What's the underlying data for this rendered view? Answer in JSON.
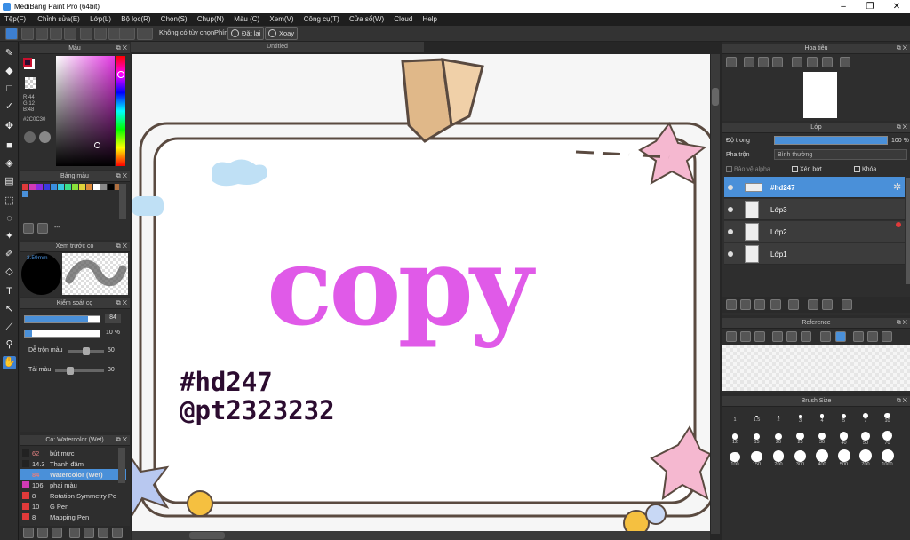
{
  "app": {
    "title": "MediBang Paint Pro (64bit)"
  },
  "menu": [
    "Tệp(F)",
    "Chỉnh sửa(E)",
    "Lớp(L)",
    "Bộ lọc(R)",
    "Chọn(S)",
    "Chụp(N)",
    "Màu (C)",
    "Xem(V)",
    "Công cụ(T)",
    "Cửa sổ(W)",
    "Cloud",
    "Help"
  ],
  "toolbar": {
    "no_option": "Không có tùy chọn",
    "phim": "Phím",
    "reset": "Đặt lại",
    "rotate": "Xoay"
  },
  "canvas": {
    "tab": "Untitled",
    "watermark1": "#hd247",
    "watermark2": "@pt2323232",
    "art_text": "copy"
  },
  "color_panel": {
    "title": "Màu",
    "r": "R:44",
    "g": "G:12",
    "b": "B:48",
    "hex": "#2C0C30",
    "fg": "#c8102e",
    "bg": "#ffffff"
  },
  "palette_panel": {
    "title": "Bảng màu",
    "dash": "---",
    "swatches": [
      "#e03a3a",
      "#d23ab5",
      "#8a2be2",
      "#3a3ae0",
      "#3a8ee0",
      "#3ac8e0",
      "#3ae08a",
      "#8ae03a",
      "#e0d23a",
      "#e08a3a",
      "#ffffff",
      "#888888",
      "#000000",
      "#b07040",
      "#4a90d9"
    ]
  },
  "brush_preview": {
    "title": "Xem trước cọ",
    "size": "3.59mm"
  },
  "brush_control": {
    "title": "Kiểm soát cọ",
    "size": "84",
    "opacity": "10 %",
    "blend_label": "Dễ trộn màu",
    "blend_value": "50",
    "reload_label": "Tải màu",
    "reload_value": "30",
    "size_frac": 0.84,
    "opacity_frac": 0.1,
    "blend_frac": 0.5,
    "reload_frac": 0.3
  },
  "brush_list": {
    "title": "Cọ: Watercolor (Wet)",
    "items": [
      {
        "size": "62",
        "name": "bút mực",
        "color": "#222222",
        "size_color": "#e08080"
      },
      {
        "size": "14.3",
        "name": "Thanh đậm",
        "color": "#222222",
        "size_color": "#dddddd"
      },
      {
        "size": "84",
        "name": "Watercolor (Wet)",
        "color": "#4a90d9",
        "size_color": "#e08080"
      },
      {
        "size": "106",
        "name": "phai màu",
        "color": "#d23ab5",
        "size_color": "#dddddd"
      },
      {
        "size": "8",
        "name": "Rotation Symmetry Pe",
        "color": "#e03a3a",
        "size_color": "#dddddd"
      },
      {
        "size": "10",
        "name": "G Pen",
        "color": "#e03a3a",
        "size_color": "#dddddd"
      },
      {
        "size": "8",
        "name": "Mapping Pen",
        "color": "#e03a3a",
        "size_color": "#dddddd"
      }
    ]
  },
  "navigator": {
    "title": "Hoa tiêu"
  },
  "layers": {
    "title": "Lớp",
    "opacity_label": "Độ trong",
    "opacity_value": "100 %",
    "blend_label": "Pha trộn",
    "blend_value": "Bình thường",
    "alpha": "Bảo vệ alpha",
    "clip": "Xén bớt",
    "lock": "Khóa",
    "items": [
      {
        "name": "#hd247"
      },
      {
        "name": "Lớp3"
      },
      {
        "name": "Lớp2"
      },
      {
        "name": "Lớp1"
      }
    ]
  },
  "reference": {
    "title": "Reference"
  },
  "brush_size": {
    "title": "Brush Size",
    "sizes": [
      "1",
      "1.5",
      "2",
      "3",
      "4",
      "5",
      "7",
      "10",
      "12",
      "15",
      "20",
      "25",
      "30",
      "40",
      "50",
      "70",
      "100",
      "150",
      "200",
      "300",
      "400",
      "500",
      "700",
      "1000"
    ]
  }
}
